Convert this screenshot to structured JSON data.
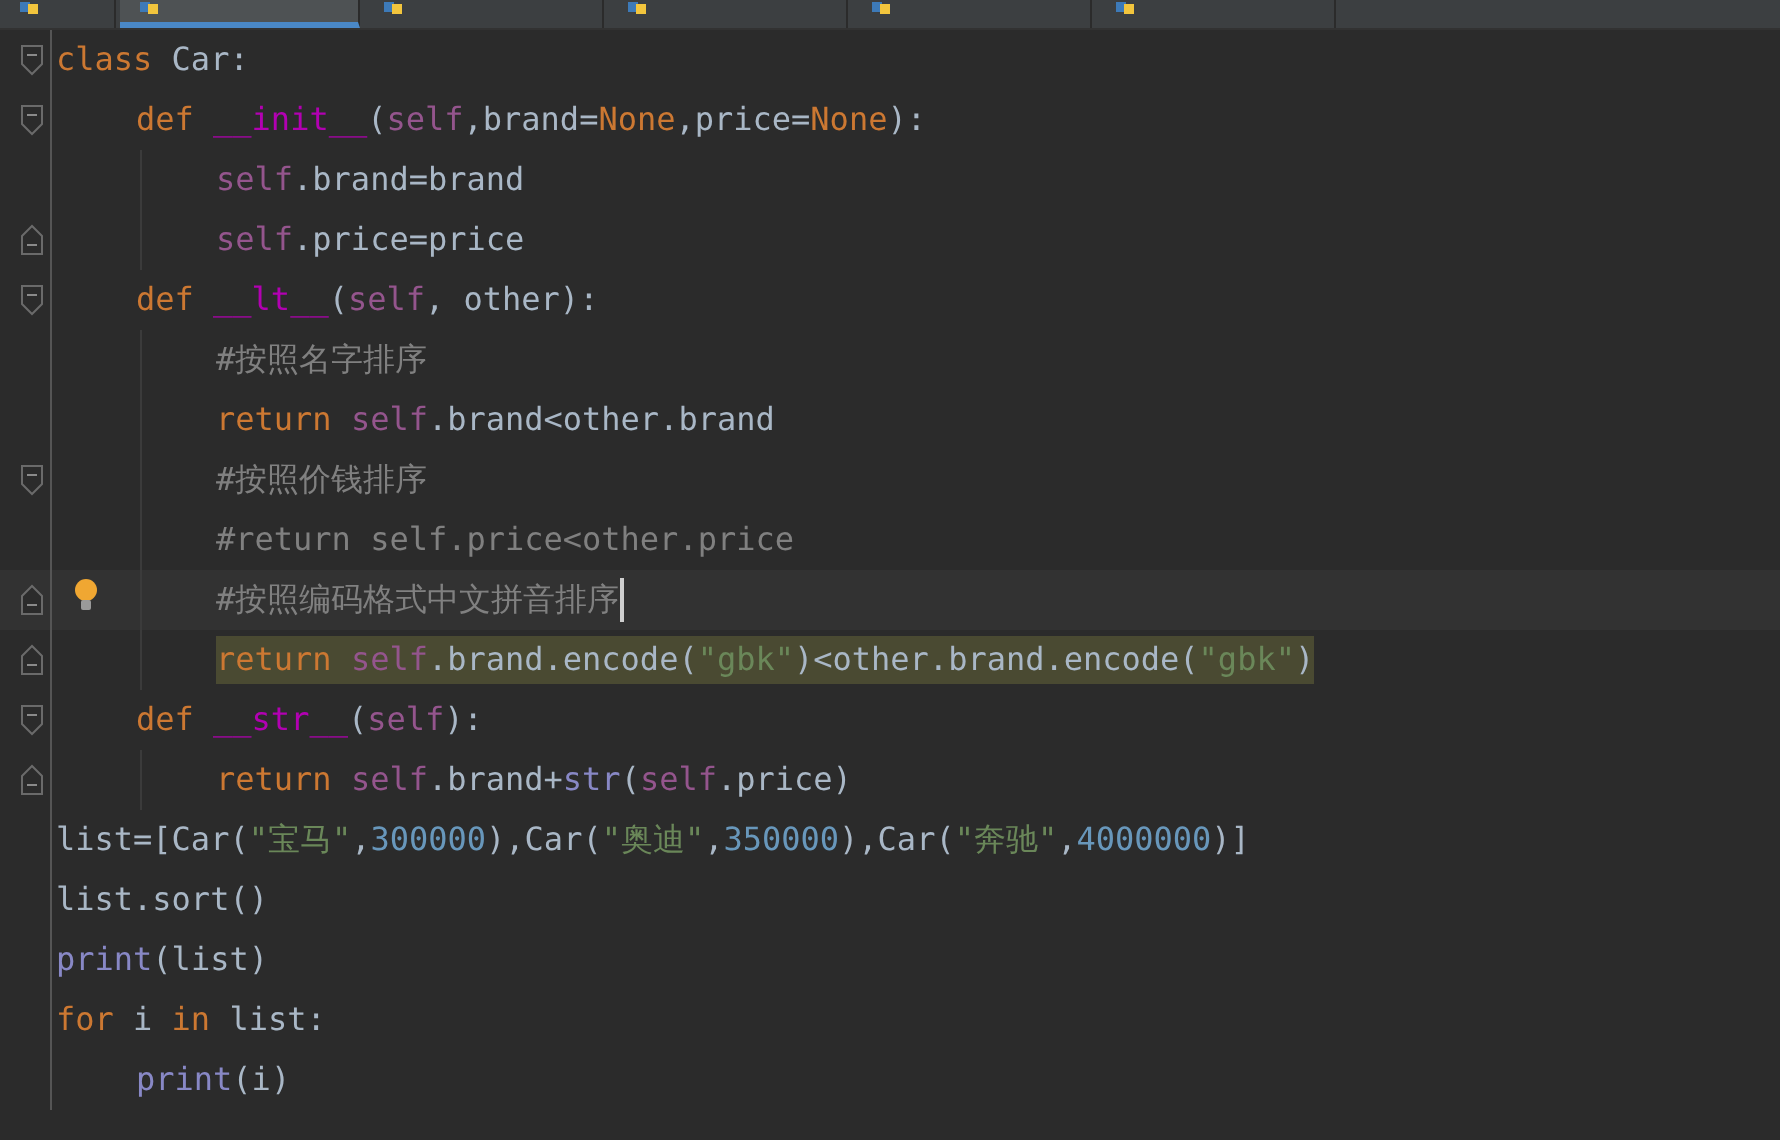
{
  "tabs": [
    {
      "selected": false
    },
    {
      "selected": true
    },
    {
      "selected": false
    },
    {
      "selected": false
    },
    {
      "selected": false
    },
    {
      "selected": false
    }
  ],
  "code": [
    {
      "kind": "opener",
      "current": false,
      "highlighted": false,
      "bulb": false,
      "tokens": [
        {
          "kind": "keyword",
          "text": "class "
        },
        {
          "kind": "plain",
          "text": "Car:"
        }
      ],
      "children": [
        {
          "kind": "opener",
          "current": false,
          "highlighted": false,
          "bulb": false,
          "tokens": [
            {
              "kind": "keyword",
              "text": "def "
            },
            {
              "kind": "magic",
              "text": "__init__"
            },
            {
              "kind": "plain",
              "text": "("
            },
            {
              "kind": "self",
              "text": "self"
            },
            {
              "kind": "plain",
              "text": ",brand="
            },
            {
              "kind": "keyword",
              "text": "None"
            },
            {
              "kind": "plain",
              "text": ",price="
            },
            {
              "kind": "keyword",
              "text": "None"
            },
            {
              "kind": "plain",
              "text": "):"
            }
          ],
          "children": [
            {
              "kind": "line",
              "current": false,
              "highlighted": false,
              "bulb": false,
              "tokens": [
                {
                  "kind": "self",
                  "text": "self"
                },
                {
                  "kind": "plain",
                  "text": ".brand=brand"
                }
              ]
            },
            {
              "kind": "closer",
              "current": false,
              "highlighted": false,
              "bulb": false,
              "tokens": [
                {
                  "kind": "self",
                  "text": "self"
                },
                {
                  "kind": "plain",
                  "text": ".price=price"
                }
              ]
            }
          ]
        },
        {
          "kind": "opener",
          "current": false,
          "highlighted": false,
          "bulb": false,
          "tokens": [
            {
              "kind": "keyword",
              "text": "def "
            },
            {
              "kind": "magic",
              "text": "__lt__"
            },
            {
              "kind": "plain",
              "text": "("
            },
            {
              "kind": "self",
              "text": "self"
            },
            {
              "kind": "plain",
              "text": ", other):"
            }
          ],
          "children": [
            {
              "kind": "line",
              "current": false,
              "highlighted": false,
              "bulb": false,
              "tokens": [
                {
                  "kind": "comment",
                  "text": "#按照名字排序"
                }
              ]
            },
            {
              "kind": "line",
              "current": false,
              "highlighted": false,
              "bulb": false,
              "tokens": [
                {
                  "kind": "keyword",
                  "text": "return "
                },
                {
                  "kind": "self",
                  "text": "self"
                },
                {
                  "kind": "plain",
                  "text": ".brand<other.brand"
                }
              ]
            },
            {
              "kind": "opener",
              "current": false,
              "highlighted": false,
              "bulb": false,
              "tokens": [
                {
                  "kind": "comment",
                  "text": "#按照价钱排序"
                }
              ]
            },
            {
              "kind": "line",
              "current": false,
              "highlighted": false,
              "bulb": false,
              "tokens": [
                {
                  "kind": "comment",
                  "text": "#return self.price<other.price"
                }
              ]
            },
            {
              "kind": "closer",
              "current": true,
              "highlighted": false,
              "bulb": true,
              "tokens": [
                {
                  "kind": "comment",
                  "text": "#按照编码格式中文拼音排序"
                }
              ]
            },
            {
              "kind": "closer",
              "current": false,
              "highlighted": true,
              "bulb": false,
              "tokens": [
                {
                  "kind": "keyword",
                  "text": "return "
                },
                {
                  "kind": "self",
                  "text": "self"
                },
                {
                  "kind": "plain",
                  "text": ".brand.encode("
                },
                {
                  "kind": "string",
                  "text": "\"gbk\""
                },
                {
                  "kind": "plain",
                  "text": ")<other.brand.encode("
                },
                {
                  "kind": "string",
                  "text": "\"gbk\""
                },
                {
                  "kind": "plain",
                  "text": ")"
                }
              ]
            }
          ]
        },
        {
          "kind": "opener",
          "current": false,
          "highlighted": false,
          "bulb": false,
          "tokens": [
            {
              "kind": "keyword",
              "text": "def "
            },
            {
              "kind": "magic",
              "text": "__str__"
            },
            {
              "kind": "plain",
              "text": "("
            },
            {
              "kind": "self",
              "text": "self"
            },
            {
              "kind": "plain",
              "text": "):"
            }
          ],
          "children": [
            {
              "kind": "closer",
              "current": false,
              "highlighted": false,
              "bulb": false,
              "tokens": [
                {
                  "kind": "keyword",
                  "text": "return "
                },
                {
                  "kind": "self",
                  "text": "self"
                },
                {
                  "kind": "plain",
                  "text": ".brand+"
                },
                {
                  "kind": "builtin",
                  "text": "str"
                },
                {
                  "kind": "plain",
                  "text": "("
                },
                {
                  "kind": "self",
                  "text": "self"
                },
                {
                  "kind": "plain",
                  "text": ".price)"
                }
              ]
            }
          ]
        }
      ]
    },
    {
      "kind": "line",
      "current": false,
      "highlighted": false,
      "bulb": false,
      "tokens": [
        {
          "kind": "plain",
          "text": "list=[Car("
        },
        {
          "kind": "string",
          "text": "\"宝马\""
        },
        {
          "kind": "plain",
          "text": ","
        },
        {
          "kind": "number",
          "text": "300000"
        },
        {
          "kind": "plain",
          "text": "),Car("
        },
        {
          "kind": "string",
          "text": "\"奥迪\""
        },
        {
          "kind": "plain",
          "text": ","
        },
        {
          "kind": "number",
          "text": "350000"
        },
        {
          "kind": "plain",
          "text": "),Car("
        },
        {
          "kind": "string",
          "text": "\"奔驰\""
        },
        {
          "kind": "plain",
          "text": ","
        },
        {
          "kind": "number",
          "text": "4000000"
        },
        {
          "kind": "plain",
          "text": ")]"
        }
      ]
    },
    {
      "kind": "line",
      "current": false,
      "highlighted": false,
      "bulb": false,
      "tokens": [
        {
          "kind": "plain",
          "text": "list.sort()"
        }
      ]
    },
    {
      "kind": "line",
      "current": false,
      "highlighted": false,
      "bulb": false,
      "tokens": [
        {
          "kind": "builtin",
          "text": "print"
        },
        {
          "kind": "plain",
          "text": "(list)"
        }
      ]
    },
    {
      "kind": "line",
      "current": false,
      "highlighted": false,
      "bulb": false,
      "tokens": [
        {
          "kind": "keyword",
          "text": "for "
        },
        {
          "kind": "plain",
          "text": "i "
        },
        {
          "kind": "keyword",
          "text": "in "
        },
        {
          "kind": "plain",
          "text": "list:"
        }
      ],
      "children": [
        {
          "kind": "line",
          "current": false,
          "highlighted": false,
          "bulb": false,
          "tokens": [
            {
              "kind": "builtin",
              "text": "print"
            },
            {
              "kind": "plain",
              "text": "(i)"
            }
          ]
        }
      ]
    }
  ]
}
